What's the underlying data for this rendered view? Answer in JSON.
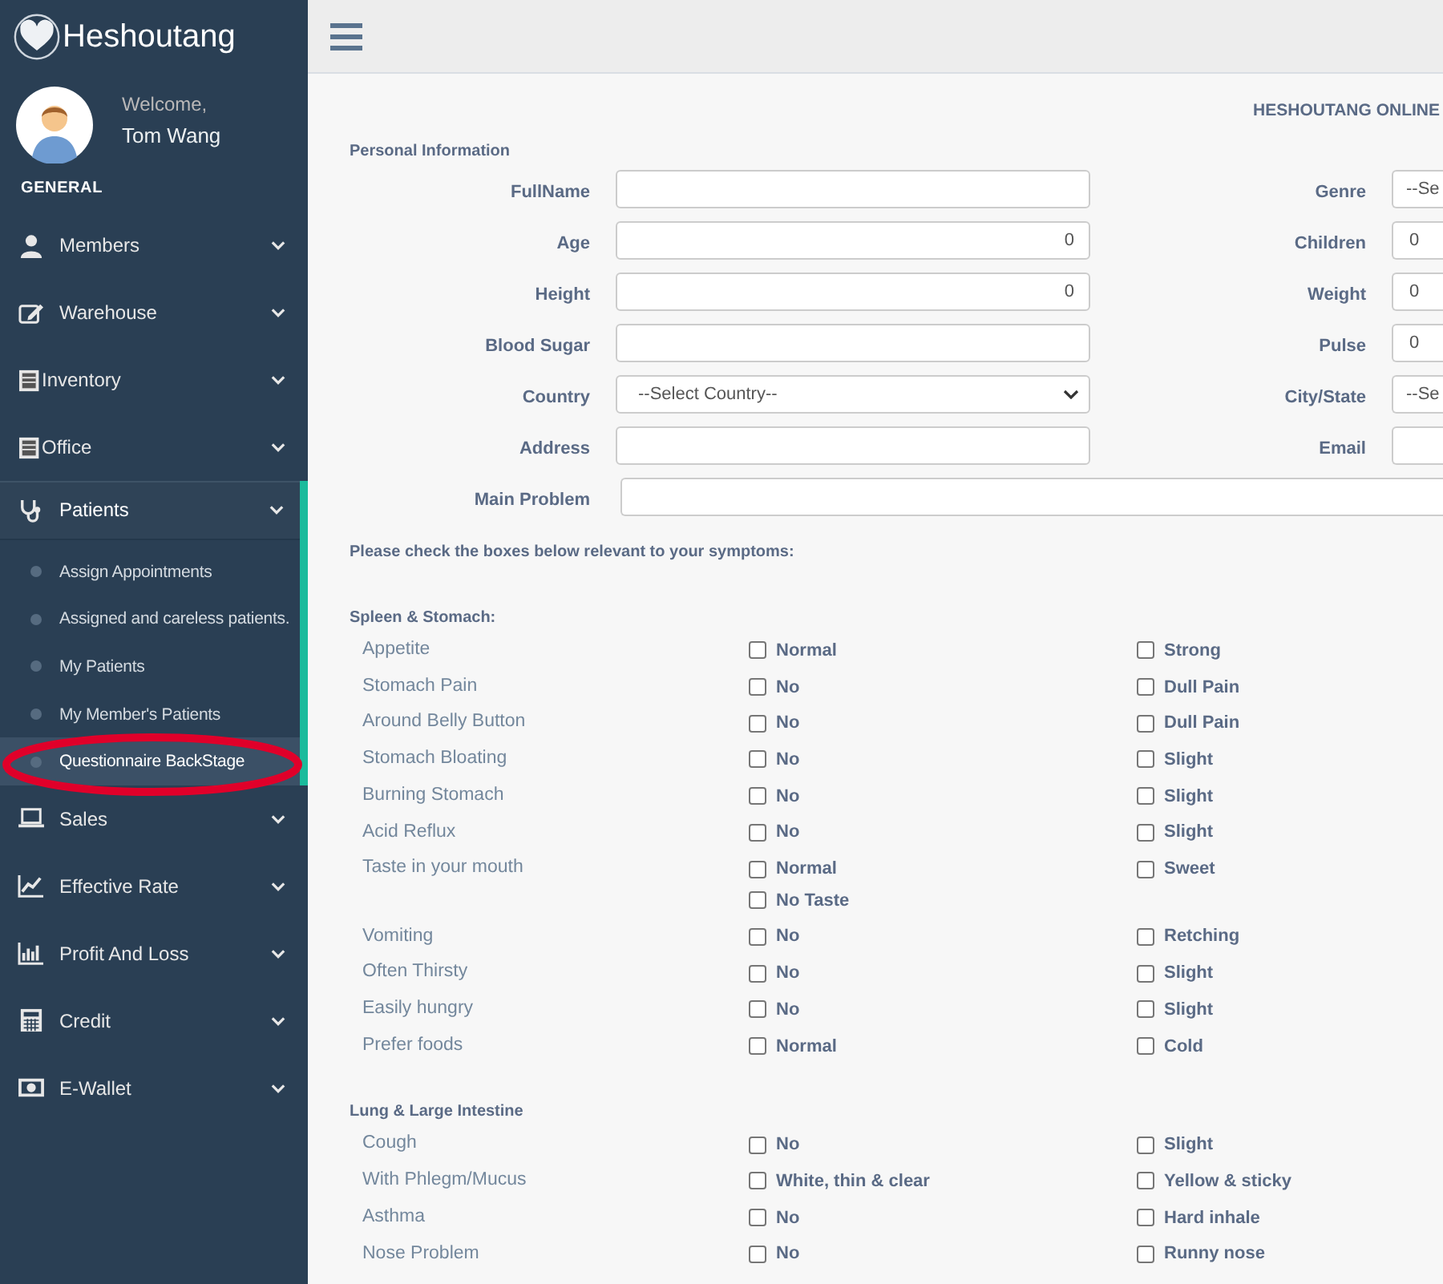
{
  "brand": {
    "name": "Heshoutang"
  },
  "profile": {
    "greeting": "Welcome,",
    "name": "Tom Wang"
  },
  "sidebar": {
    "section_title": "GENERAL",
    "items": [
      {
        "label": "Members",
        "selected": false
      },
      {
        "label": "Warehouse",
        "selected": false
      },
      {
        "label": "Inventory",
        "selected": false
      },
      {
        "label": "Office",
        "selected": false
      },
      {
        "label": "Patients",
        "selected": true,
        "children": [
          {
            "label": "Assign Appointments",
            "selected": false
          },
          {
            "label": "Assigned and careless patients.",
            "selected": false
          },
          {
            "label": "My Patients",
            "selected": false
          },
          {
            "label": "My Member's Patients",
            "selected": false
          },
          {
            "label": "Questionnaire BackStage",
            "selected": true
          }
        ]
      },
      {
        "label": "Sales",
        "selected": false
      },
      {
        "label": "Effective Rate",
        "selected": false
      },
      {
        "label": "Profit And Loss",
        "selected": false
      },
      {
        "label": "Credit",
        "selected": false
      },
      {
        "label": "E-Wallet",
        "selected": false
      }
    ]
  },
  "page_heading": "HESHOUTANG ONLINE",
  "personal_information": {
    "title": "Personal Information",
    "fields": [
      {
        "left": {
          "label": "FullName",
          "kind": "text"
        },
        "right": {
          "label": "Genre",
          "kind": "select",
          "value": "--Se"
        }
      },
      {
        "left": {
          "label": "Age",
          "kind": "number",
          "value": "0"
        },
        "right": {
          "label": "Children",
          "kind": "text",
          "value": "0"
        }
      },
      {
        "left": {
          "label": "Height",
          "kind": "number",
          "value": "0"
        },
        "right": {
          "label": "Weight",
          "kind": "text",
          "value": "0"
        }
      },
      {
        "left": {
          "label": "Blood Sugar",
          "kind": "text"
        },
        "right": {
          "label": "Pulse",
          "kind": "text",
          "value": "0"
        }
      },
      {
        "left": {
          "label": "Country",
          "kind": "select",
          "value": "--Select Country--"
        },
        "right": {
          "label": "City/State",
          "kind": "select",
          "value": "--Se"
        }
      },
      {
        "left": {
          "label": "Address",
          "kind": "text"
        },
        "right": {
          "label": "Email",
          "kind": "text"
        }
      }
    ],
    "main_problem": {
      "label": "Main Problem"
    }
  },
  "instructions": "Please check the boxes below relevant to your symptoms:",
  "sections": [
    {
      "title": "Spleen & Stomach:",
      "rows": [
        {
          "label": "Appetite",
          "columns": [
            [
              {
                "label": "Normal",
                "checked": false
              }
            ],
            [
              {
                "label": "Strong",
                "checked": false
              }
            ]
          ]
        },
        {
          "label": "Stomach Pain",
          "columns": [
            [
              {
                "label": "No",
                "checked": false
              }
            ],
            [
              {
                "label": "Dull Pain",
                "checked": false
              }
            ]
          ]
        },
        {
          "label": "Around Belly Button",
          "columns": [
            [
              {
                "label": "No",
                "checked": false
              }
            ],
            [
              {
                "label": "Dull Pain",
                "checked": false
              }
            ]
          ]
        },
        {
          "label": "Stomach Bloating",
          "columns": [
            [
              {
                "label": "No",
                "checked": false
              }
            ],
            [
              {
                "label": "Slight",
                "checked": false
              }
            ]
          ]
        },
        {
          "label": "Burning Stomach",
          "columns": [
            [
              {
                "label": "No",
                "checked": false
              }
            ],
            [
              {
                "label": "Slight",
                "checked": false
              }
            ]
          ]
        },
        {
          "label": "Acid Reflux",
          "columns": [
            [
              {
                "label": "No",
                "checked": false
              }
            ],
            [
              {
                "label": "Slight",
                "checked": false
              }
            ]
          ]
        },
        {
          "label": "Taste in your mouth",
          "columns": [
            [
              {
                "label": "Normal",
                "checked": false
              },
              {
                "label": "No Taste",
                "checked": false
              }
            ],
            [
              {
                "label": "Sweet",
                "checked": false
              }
            ]
          ]
        },
        {
          "label": "Vomiting",
          "columns": [
            [
              {
                "label": "No",
                "checked": false
              }
            ],
            [
              {
                "label": "Retching",
                "checked": false
              }
            ]
          ]
        },
        {
          "label": "Often Thirsty",
          "columns": [
            [
              {
                "label": "No",
                "checked": false
              }
            ],
            [
              {
                "label": "Slight",
                "checked": false
              }
            ]
          ]
        },
        {
          "label": "Easily hungry",
          "columns": [
            [
              {
                "label": "No",
                "checked": false
              }
            ],
            [
              {
                "label": "Slight",
                "checked": false
              }
            ]
          ]
        },
        {
          "label": "Prefer foods",
          "columns": [
            [
              {
                "label": "Normal",
                "checked": false
              }
            ],
            [
              {
                "label": "Cold",
                "checked": false
              }
            ]
          ]
        }
      ]
    },
    {
      "title": "Lung & Large Intestine",
      "rows": [
        {
          "label": "Cough",
          "columns": [
            [
              {
                "label": "No",
                "checked": false
              }
            ],
            [
              {
                "label": "Slight",
                "checked": false
              }
            ]
          ]
        },
        {
          "label": "With Phlegm/Mucus",
          "columns": [
            [
              {
                "label": "White, thin & clear",
                "checked": false
              }
            ],
            [
              {
                "label": "Yellow & sticky",
                "checked": false
              }
            ]
          ]
        },
        {
          "label": "Asthma",
          "columns": [
            [
              {
                "label": "No",
                "checked": false
              }
            ],
            [
              {
                "label": "Hard inhale",
                "checked": false
              }
            ]
          ]
        },
        {
          "label": "Nose Problem",
          "columns": [
            [
              {
                "label": "No",
                "checked": false
              }
            ],
            [
              {
                "label": "Runny nose",
                "checked": false
              }
            ]
          ]
        }
      ]
    }
  ]
}
